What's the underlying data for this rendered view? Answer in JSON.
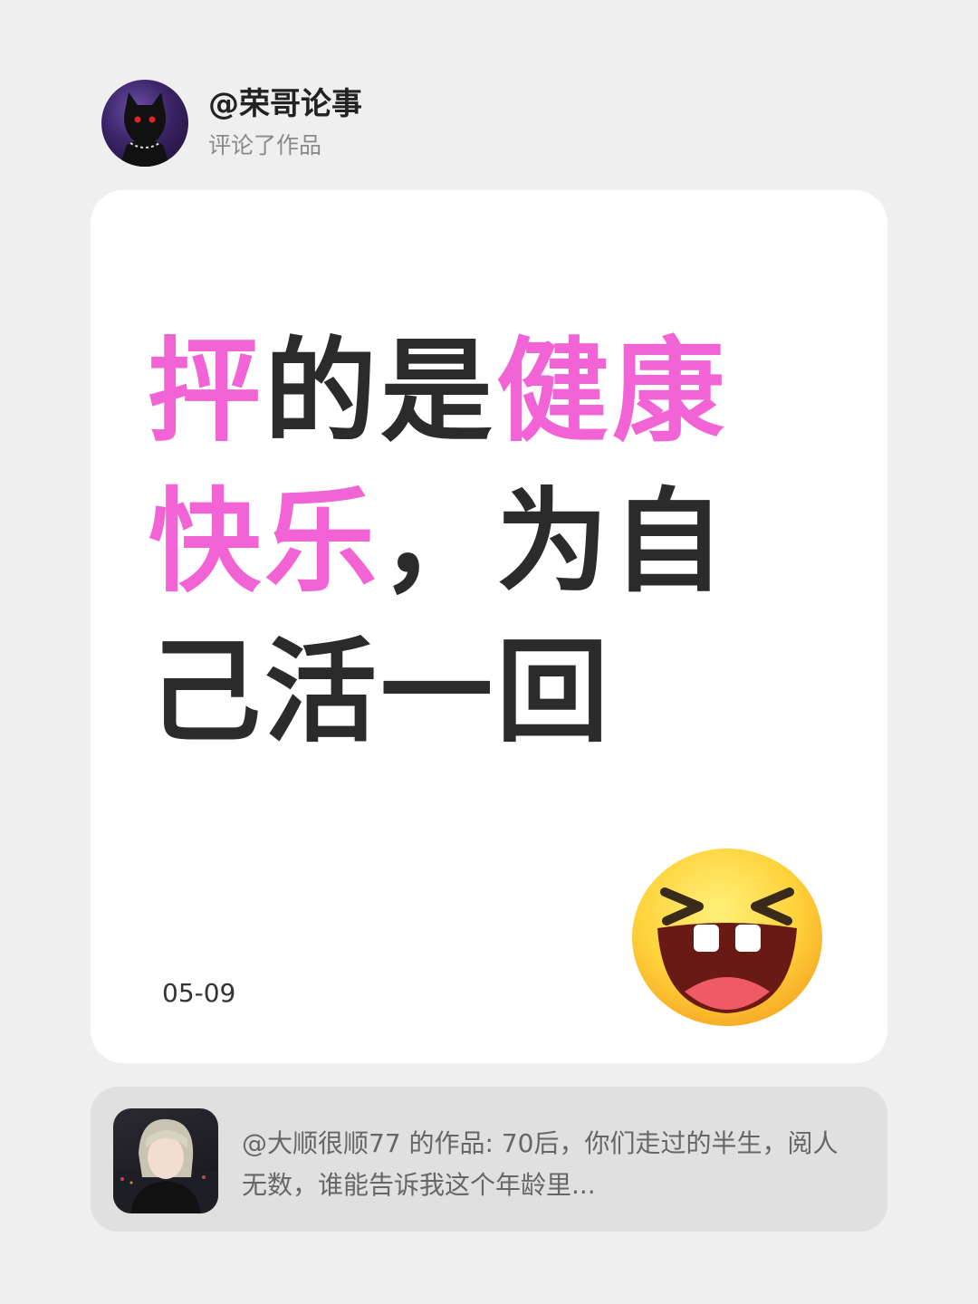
{
  "header": {
    "username": "@荣哥论事",
    "action": "评论了作品"
  },
  "comment": {
    "segments": [
      {
        "text": "抨",
        "highlight": true
      },
      {
        "text": "的是",
        "highlight": false
      },
      {
        "text": "健康快乐",
        "highlight": true
      },
      {
        "text": "，为自己活一回",
        "highlight": false
      }
    ],
    "date": "05-09",
    "emoji": "laughing-face-icon"
  },
  "reference": {
    "text": "@大顺很顺77 的作品: 70后，你们走过的半生，阅人无数，谁能告诉我这个年龄里..."
  },
  "colors": {
    "highlight": "#f263d6",
    "text": "#2b2b2b",
    "background": "#efefef"
  }
}
